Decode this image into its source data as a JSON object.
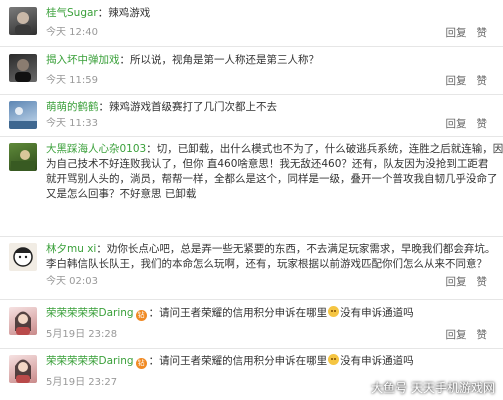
{
  "actions": {
    "reply": "回复",
    "like": "赞"
  },
  "comments": [
    {
      "user": "桂气Sugar",
      "text": "辣鸡游戏",
      "time": "今天 12:40",
      "has_like": true,
      "avatar": "avatar-gray-portrait"
    },
    {
      "user": "揭入坏中弹加戏",
      "text": "所以说，视角是第一人称还是第三人称？",
      "time": "今天 11:59",
      "has_like": true,
      "avatar": "avatar-dark-portrait"
    },
    {
      "user": "萌萌的鹤鹤",
      "text": "辣鸡游戏首级赛打了几门次都上不去",
      "time": "今天 11:33",
      "has_like": true,
      "avatar": "avatar-blue-scene"
    },
    {
      "user": "大黑踩海人心杂0103",
      "lines": [
        "切，已卸载，出什么模式也不为了，什么破逃兵系统，连胜之后就连输，因",
        "为自己技术不好连败我认了，但你    直460啥意思！我无敌还460？还有，队友因为没抢到工距君",
        "就开骂别人头的，淌员，帮帮一样，全都么是这个，同样是一级，叠开一个普攻我自韧几乎没命了",
        "又是怎么回事？不好意思    已卸载"
      ],
      "time": "",
      "has_like": false,
      "avatar": "avatar-green-scene"
    },
    {
      "user": "林夕mu xi",
      "lines": [
        "劝你长点心吧，总是弄一些无紧要的东西，不去满足玩家需求，早晚我们都会弃坑。",
        "李白韩信队长队王，我们的本命怎么玩啊，还有，玩家根据以前游戏匹配你们怎么从来不同意？"
      ],
      "time": "今天 02:03",
      "has_like": true,
      "avatar": "avatar-cartoon"
    },
    {
      "user": "荣荣荣荣荣Daring",
      "text": "请问王者荣耀的信用积分申诉在哪里",
      "text2": "没有申诉通道吗",
      "time": "5月19日 23:28",
      "has_like": true,
      "has_badge": true,
      "avatar": "avatar-pink-portrait"
    },
    {
      "user": "荣荣荣荣荣Daring",
      "text": "请问王者荣耀的信用积分申诉在哪里",
      "text2": "没有申诉通道吗",
      "time": "5月19日 23:27",
      "has_like": true,
      "has_badge": true,
      "avatar": "avatar-pink-portrait"
    }
  ],
  "watermark": "大鱼号 天天手机游戏网",
  "badge_text": "钻"
}
